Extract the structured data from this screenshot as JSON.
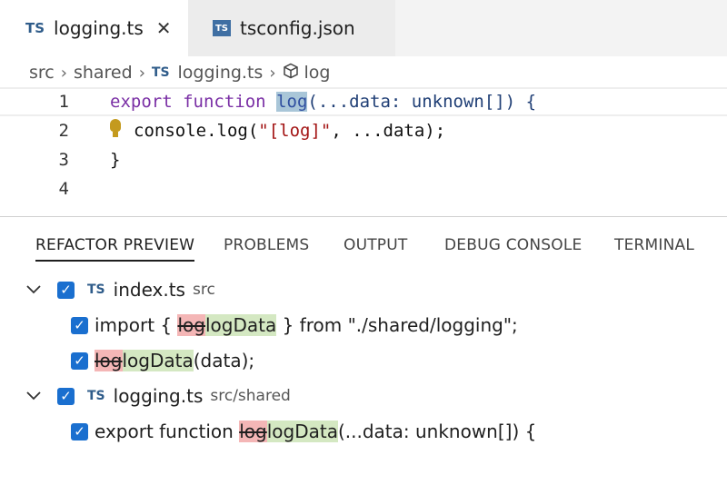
{
  "tabs": [
    {
      "badge": "TS",
      "label": "logging.ts",
      "close": "✕"
    },
    {
      "badge": "TS",
      "label": "tsconfig.json"
    }
  ],
  "breadcrumb": {
    "folder1": "src",
    "folder2": "shared",
    "file_badge": "TS",
    "file": "logging.ts",
    "symbol": "log",
    "sep": "›"
  },
  "editor": {
    "lines": [
      {
        "number": "1",
        "tokens": {
          "export": "export",
          "function": "function",
          "name": "log",
          "rest": "(...data: unknown[]) {"
        }
      },
      {
        "number": "2",
        "tokens": {
          "call": "console.log(",
          "str": "\"[log]\"",
          "rest": ", ...data);"
        }
      },
      {
        "number": "3",
        "tokens": {
          "text": "}"
        }
      },
      {
        "number": "4",
        "tokens": {
          "text": ""
        }
      }
    ]
  },
  "panel": {
    "tabs": [
      "REFACTOR PREVIEW",
      "PROBLEMS",
      "OUTPUT",
      "DEBUG CONSOLE",
      "TERMINAL"
    ],
    "active_tab": "REFACTOR PREVIEW"
  },
  "refactor": {
    "files": [
      {
        "badge": "TS",
        "name": "index.ts",
        "path": "src",
        "checked": true,
        "changes": [
          {
            "checked": true,
            "before": "import { ",
            "old": "log",
            "new": "logData",
            "after": " } from \"./shared/logging\";"
          },
          {
            "checked": true,
            "before": "",
            "old": "log",
            "new": "logData",
            "after": "(data);"
          }
        ]
      },
      {
        "badge": "TS",
        "name": "logging.ts",
        "path": "src/shared",
        "checked": true,
        "changes": [
          {
            "checked": true,
            "before": "export function ",
            "old": "log",
            "new": "logData",
            "after": "(...data: unknown[]) {"
          }
        ]
      }
    ]
  },
  "icons": {
    "chevron": "chevron-down-icon",
    "checkbox": "checkbox-checked-icon",
    "bulb": "lightbulb-icon",
    "symbol": "method-cube-icon"
  },
  "colors": {
    "accent": "#1a6fcf",
    "ts_badge": "#2f5c8a",
    "deleted": "#f4b6b6",
    "inserted": "#d4e8c2"
  }
}
